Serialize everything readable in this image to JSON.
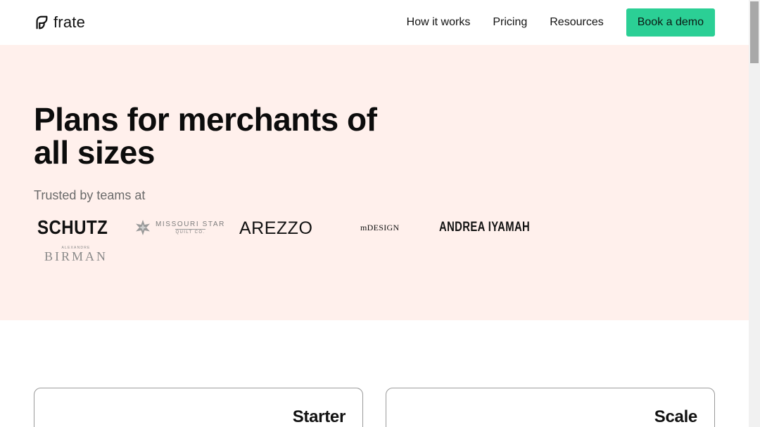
{
  "header": {
    "logo_text": "frate",
    "logo_icon": "frate-leaf-icon",
    "nav": [
      {
        "label": "How it works"
      },
      {
        "label": "Pricing"
      },
      {
        "label": "Resources"
      }
    ],
    "cta_label": "Book a demo"
  },
  "hero": {
    "title": "Plans for merchants of all sizes",
    "trusted_label": "Trusted by teams at",
    "logos": [
      {
        "name": "SCHUTZ"
      },
      {
        "name": "MISSOURI STAR",
        "sub": "QUILT CO."
      },
      {
        "name": "AREZZO"
      },
      {
        "name": "mDESIGN"
      },
      {
        "name": "ANDREA IYAMAH"
      },
      {
        "name": "BIRMAN",
        "small": "ALEXANDRE"
      }
    ]
  },
  "plans": [
    {
      "title": "Starter"
    },
    {
      "title": "Scale"
    }
  ],
  "colors": {
    "accent": "#2bcf95",
    "hero_bg": "#fff0ec",
    "text": "#111111",
    "muted": "#6a6a6a"
  }
}
